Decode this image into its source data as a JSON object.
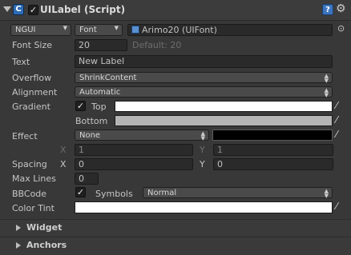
{
  "header": {
    "component_title": "UILabel (Script)",
    "icon_letter": "C",
    "help_glyph": "?",
    "gear_glyph": "⚙"
  },
  "font_row": {
    "source_option": "NGUI",
    "type_option": "Font",
    "font_value": "Arimo20 (UIFont)"
  },
  "font_size": {
    "label": "Font Size",
    "value": "20",
    "default_text": "Default: 20"
  },
  "text": {
    "label": "Text",
    "value": "New Label"
  },
  "overflow": {
    "label": "Overflow",
    "value": "ShrinkContent"
  },
  "alignment": {
    "label": "Alignment",
    "value": "Automatic"
  },
  "gradient": {
    "label": "Gradient",
    "top_label": "Top",
    "bottom_label": "Bottom",
    "top_color": "#ffffff",
    "bottom_color": "#b4b4b4"
  },
  "effect": {
    "label": "Effect",
    "value": "None",
    "color": "#000000",
    "x_label": "X",
    "x_value": "1",
    "y_label": "Y",
    "y_value": "1"
  },
  "spacing": {
    "label": "Spacing",
    "x_label": "X",
    "x_value": "0",
    "y_label": "Y",
    "y_value": "0"
  },
  "max_lines": {
    "label": "Max Lines",
    "value": "0"
  },
  "bbcode": {
    "label": "BBCode",
    "symbols_label": "Symbols",
    "symbols_value": "Normal"
  },
  "color_tint": {
    "label": "Color Tint",
    "color": "#ffffff"
  },
  "sections": {
    "widget": "Widget",
    "anchors": "Anchors"
  }
}
